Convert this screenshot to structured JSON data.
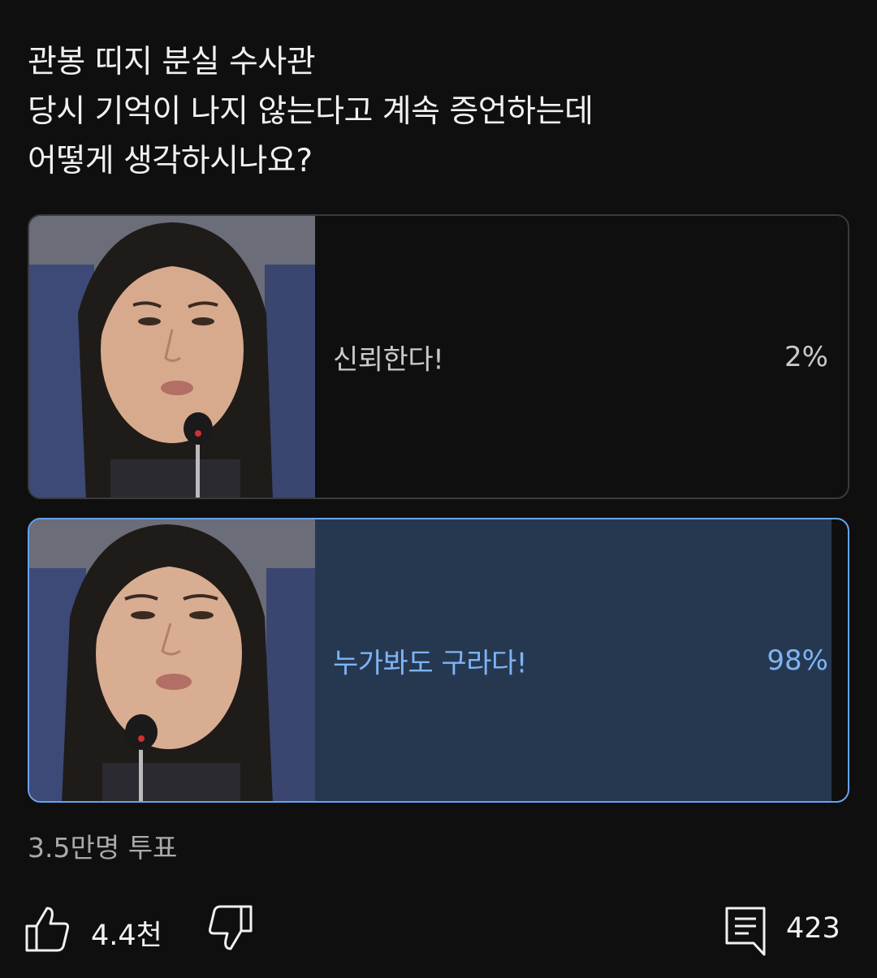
{
  "post": {
    "question_lines": [
      "관봉 띠지 분실 수사관",
      "당시 기억이 나지 않는다고 계속 증언하는데",
      "어떻게 생각하시나요?"
    ]
  },
  "poll": {
    "options": [
      {
        "label": "신뢰한다!",
        "percent_text": "2%",
        "percent": 2,
        "selected": false
      },
      {
        "label": "누가봐도 구라다!",
        "percent_text": "98%",
        "percent": 98,
        "selected": true
      }
    ],
    "vote_count": "3.5만명 투표"
  },
  "actions": {
    "like_count": "4.4천",
    "comment_count": "423",
    "icons": [
      "thumbs-up-icon",
      "thumbs-down-icon",
      "comment-icon"
    ]
  },
  "colors": {
    "background": "#0f0f0f",
    "accent": "#65a4f0",
    "selected_fill": "#263850",
    "unselected_fill": "#3a3a3a"
  }
}
